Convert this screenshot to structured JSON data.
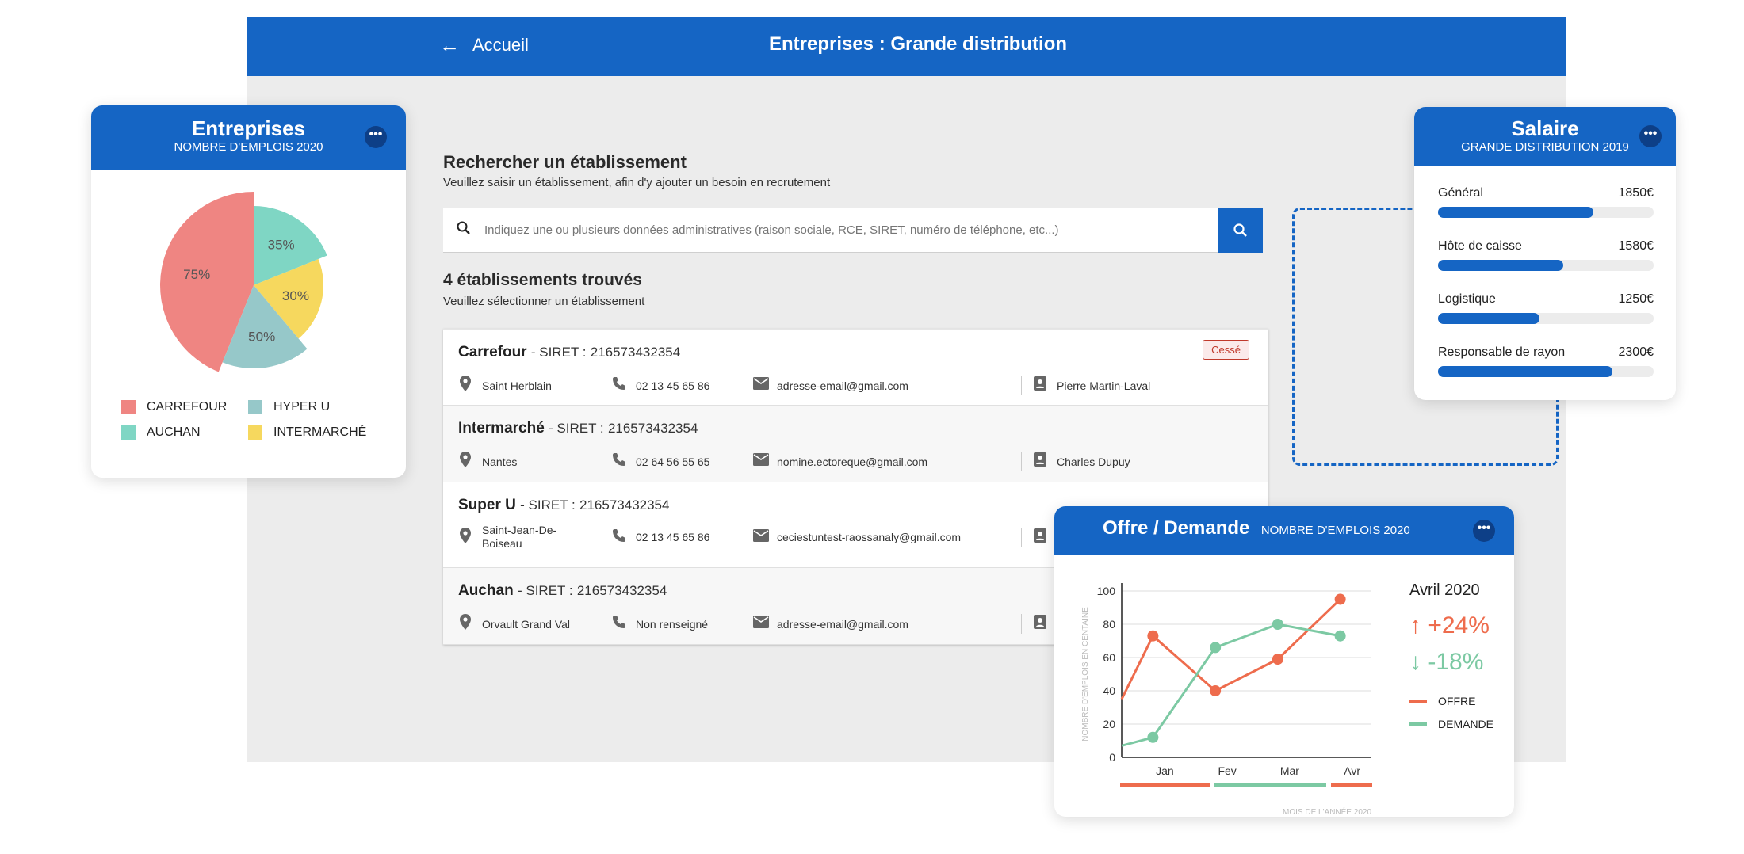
{
  "header": {
    "back_label": "Accueil",
    "title": "Entreprises : Grande distribution"
  },
  "search": {
    "heading": "Rechercher un établissement",
    "subheading": "Veuillez saisir un établissement, afin d'y ajouter un besoin en recrutement",
    "placeholder": "Indiquez une ou plusieurs données administratives (raison sociale, RCE, SIRET, numéro de téléphone, etc...)"
  },
  "results": {
    "heading": "4 établissements trouvés",
    "subheading": "Veuillez sélectionner un établissement",
    "siret_prefix": "- SIRET :",
    "items": [
      {
        "name": "Carrefour",
        "siret": "216573432354",
        "badge": "Cessé",
        "location": "Saint Herblain",
        "phone": "02 13 45 65 86",
        "email": "adresse-email@gmail.com",
        "contact": "Pierre Martin-Laval"
      },
      {
        "name": "Intermarché",
        "siret": "216573432354",
        "location": "Nantes",
        "phone": "02 64 56 55 65",
        "email": "nomine.ectoreque@gmail.com",
        "contact": "Charles Dupuy"
      },
      {
        "name": "Super U",
        "siret": "216573432354",
        "location": "Saint-Jean-De-Boiseau",
        "phone": "02 13 45 65 86",
        "email": "ceciestuntest-raossanaly@gmail.com",
        "contact": ""
      },
      {
        "name": "Auchan",
        "siret": "216573432354",
        "location": "Orvault Grand Val",
        "phone": "Non renseigné",
        "email": "adresse-email@gmail.com",
        "contact": ""
      }
    ]
  },
  "icons": {
    "back": "arrow-left-icon",
    "search": "search-icon",
    "location": "map-pin-icon",
    "phone": "phone-icon",
    "email": "mail-icon",
    "contact": "contact-card-icon",
    "more": "more-dots-icon"
  },
  "colors": {
    "primary": "#1565c4",
    "carrefour": "#ef8582",
    "hyper_u": "#96c8c9",
    "auchan": "#7fd6c4",
    "intermarche": "#f6d85e",
    "offre": "#ee6c4d",
    "demande": "#7cc9a3"
  },
  "entreprises_card": {
    "title": "Entreprises",
    "subtitle": "NOMBRE D'EMPLOIS 2020",
    "more": "•••",
    "chart_data": {
      "type": "pie",
      "slices": [
        {
          "label": "CARREFOUR",
          "value": 75,
          "text": "75%"
        },
        {
          "label": "AUCHAN",
          "value": 35,
          "text": "35%"
        },
        {
          "label": "INTERMARCHÉ",
          "value": 30,
          "text": "30%"
        },
        {
          "label": "HYPER U",
          "value": 50,
          "text": "50%"
        }
      ],
      "legend": [
        "CARREFOUR",
        "HYPER U",
        "AUCHAN",
        "INTERMARCHÉ"
      ]
    }
  },
  "salaire_card": {
    "title": "Salaire",
    "subtitle": "GRANDE DISTRIBUTION 2019",
    "more": "•••",
    "items": [
      {
        "label": "Général",
        "value": "1850€",
        "fill": 0.72
      },
      {
        "label": "Hôte de caisse",
        "value": "1580€",
        "fill": 0.58
      },
      {
        "label": "Logistique",
        "value": "1250€",
        "fill": 0.47
      },
      {
        "label": "Responsable de rayon",
        "value": "2300€",
        "fill": 0.81
      }
    ]
  },
  "offre_card": {
    "title": "Offre / Demande",
    "subtitle": "NOMBRE D'EMPLOIS 2020",
    "more": "•••",
    "month": "Avril 2020",
    "up": "+24%",
    "down": "-18%",
    "chart_data": {
      "type": "line",
      "ylabel": "NOMBRE D'EMPLOIS EN CENTAINE",
      "xlabel": "MOIS DE L'ANNÉE 2020",
      "ylim": [
        0,
        100
      ],
      "yticks": [
        0,
        20,
        40,
        60,
        80,
        100
      ],
      "categories": [
        "Jan",
        "Fev",
        "Mar",
        "Avr"
      ],
      "series": [
        {
          "name": "OFFRE",
          "x": [
            0,
            0.5,
            1.5,
            2.5,
            3.5
          ],
          "values": [
            35,
            73,
            40,
            59,
            95
          ]
        },
        {
          "name": "DEMANDE",
          "x": [
            0,
            0.5,
            1.5,
            2.5,
            3.5
          ],
          "values": [
            7,
            12,
            66,
            80,
            73
          ]
        }
      ]
    }
  }
}
